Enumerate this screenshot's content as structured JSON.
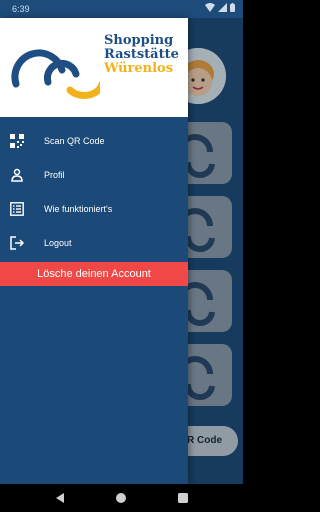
{
  "status_bar": {
    "time": "6:39"
  },
  "logo": {
    "line1": "Shopping",
    "line2": "Raststätte",
    "line3": "Würenlos"
  },
  "menu": {
    "items": [
      {
        "label": "Scan QR Code",
        "icon": "qr-code-icon"
      },
      {
        "label": "Profil",
        "icon": "person-icon"
      },
      {
        "label": "Wie funktioniert's",
        "icon": "list-icon"
      },
      {
        "label": "Logout",
        "icon": "logout-icon"
      }
    ],
    "delete_label": "Lösche deinen Account"
  },
  "background": {
    "qr_button_label": "R Code"
  },
  "colors": {
    "primary": "#1b4a78",
    "logo_blue": "#1f4e82",
    "logo_yellow": "#f2b21c",
    "danger": "#f04747"
  }
}
